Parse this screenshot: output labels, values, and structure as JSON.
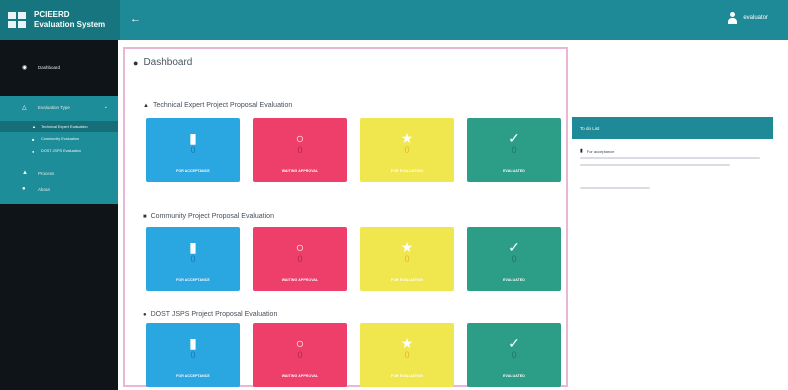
{
  "app": {
    "brand_line1": "PCIEERD",
    "brand_line2": "Evaluation System",
    "back_icon": "arrow-left-icon",
    "user_name": "evaluator"
  },
  "sidebar": {
    "items": [
      {
        "label": "Dashboard",
        "icon": "dashboard-icon"
      },
      {
        "label": "Evaluation Type",
        "icon": "clipboard-icon"
      },
      {
        "label": "Process",
        "icon": "process-icon"
      },
      {
        "label": "About",
        "icon": "info-icon"
      }
    ],
    "subitems": [
      {
        "label": "Technical Expert Evaluation",
        "icon": "user-icon"
      },
      {
        "label": "Community Evaluation",
        "icon": "users-icon"
      },
      {
        "label": "DOST JSPS Evaluation",
        "icon": "globe-icon"
      }
    ]
  },
  "dashboard": {
    "title": "Dashboard",
    "sections": [
      {
        "title": "Technical Expert Project Proposal Evaluation",
        "icon": "user-icon",
        "cards": [
          {
            "label": "FOR ACCEPTANCE",
            "count": "0",
            "icon": "file-icon"
          },
          {
            "label": "WAITING APPROVAL",
            "count": "0",
            "icon": "hand-icon"
          },
          {
            "label": "FOR EVALUATION",
            "count": "0",
            "icon": "star-icon"
          },
          {
            "label": "EVALUATED",
            "count": "0",
            "icon": "check-icon"
          }
        ]
      },
      {
        "title": "Community Project Proposal Evaluation",
        "icon": "users-icon",
        "cards": [
          {
            "label": "FOR ACCEPTANCE",
            "count": "0",
            "icon": "file-icon"
          },
          {
            "label": "WAITING APPROVAL",
            "count": "0",
            "icon": "hand-icon"
          },
          {
            "label": "FOR EVALUATION",
            "count": "0",
            "icon": "star-icon"
          },
          {
            "label": "EVALUATED",
            "count": "0",
            "icon": "check-icon"
          }
        ]
      },
      {
        "title": "DOST JSPS Project Proposal Evaluation",
        "icon": "globe-icon",
        "cards": [
          {
            "label": "FOR ACCEPTANCE",
            "count": "0",
            "icon": "file-icon"
          },
          {
            "label": "WAITING APPROVAL",
            "count": "0",
            "icon": "hand-icon"
          },
          {
            "label": "FOR EVALUATION",
            "count": "0",
            "icon": "star-icon"
          },
          {
            "label": "EVALUATED",
            "count": "0",
            "icon": "check-icon"
          }
        ]
      }
    ]
  },
  "todo": {
    "title": "To do List",
    "item_label": "For acceptance"
  },
  "colors": {
    "topbar": "#1f8a97",
    "card_blue": "#2aa6e0",
    "card_red": "#ee3f6b",
    "card_yellow": "#f0e64e",
    "card_green": "#2c9d86"
  }
}
